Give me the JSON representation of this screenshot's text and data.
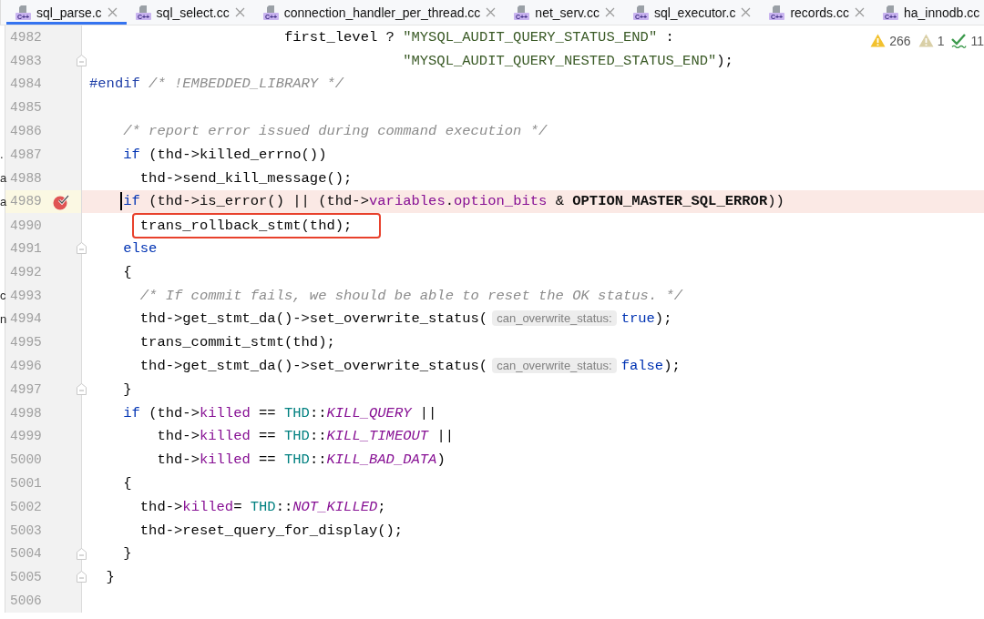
{
  "tabs": [
    {
      "label": "sql_parse.c",
      "icon_label": "C++",
      "selected": true
    },
    {
      "label": "sql_select.cc",
      "icon_label": "C++",
      "selected": false
    },
    {
      "label": "connection_handler_per_thread.cc",
      "icon_label": "C++",
      "selected": false
    },
    {
      "label": "net_serv.cc",
      "icon_label": "C++",
      "selected": false
    },
    {
      "label": "sql_executor.c",
      "icon_label": "C++",
      "selected": false
    },
    {
      "label": "records.cc",
      "icon_label": "C++",
      "selected": false
    },
    {
      "label": "ha_innodb.cc",
      "icon_label": "C++",
      "selected": false
    }
  ],
  "inspections": [
    {
      "kind": "warning",
      "count": "266"
    },
    {
      "kind": "weak_warning",
      "count": "1"
    },
    {
      "kind": "typo",
      "count": "11"
    }
  ],
  "lines": [
    {
      "number": "4982",
      "breakpoint": false,
      "fold_marker": false,
      "annotated": false,
      "caret": false,
      "tokens": [
        {
          "kind": "plain",
          "text": "                       first_level ? "
        },
        {
          "kind": "string",
          "text": "\"MYSQL_AUDIT_QUERY_STATUS_END\""
        },
        {
          "kind": "plain",
          "text": " :"
        }
      ]
    },
    {
      "number": "4983",
      "breakpoint": false,
      "fold_marker": true,
      "annotated": false,
      "caret": false,
      "tokens": [
        {
          "kind": "string",
          "text": "                                     \"MYSQL_AUDIT_QUERY_NESTED_STATUS_END\""
        },
        {
          "kind": "plain",
          "text": ");"
        }
      ]
    },
    {
      "number": "4984",
      "breakpoint": false,
      "fold_marker": false,
      "annotated": false,
      "caret": false,
      "tokens": [
        {
          "kind": "preproc",
          "text": "#endif"
        },
        {
          "kind": "comment",
          "text": " /* !EMBEDDED_LIBRARY */"
        }
      ]
    },
    {
      "number": "4985",
      "breakpoint": false,
      "fold_marker": false,
      "annotated": false,
      "caret": false
    },
    {
      "number": "4986",
      "breakpoint": false,
      "fold_marker": false,
      "annotated": false,
      "caret": false,
      "tokens": [
        {
          "kind": "comment",
          "text": "    /* report error issued during command execution */"
        }
      ]
    },
    {
      "number": "4987",
      "side_text": ".",
      "breakpoint": false,
      "fold_marker": false,
      "annotated": false,
      "caret": false,
      "tokens": [
        {
          "kind": "keyword",
          "text": "    if"
        },
        {
          "kind": "plain",
          "text": " (thd->killed_errno())"
        }
      ]
    },
    {
      "number": "4988",
      "side_text": "a",
      "breakpoint": false,
      "fold_marker": false,
      "annotated": false,
      "caret": false,
      "tokens": [
        {
          "kind": "plain",
          "text": "      thd->send_kill_message();"
        }
      ]
    },
    {
      "number": "4989",
      "side_text": "a",
      "breakpoint": true,
      "fold_marker": false,
      "annotated": false,
      "caret": true,
      "tokens": [
        {
          "kind": "keyword",
          "text": "    if"
        },
        {
          "kind": "plain",
          "text": " (thd->is_error() || (thd->"
        },
        {
          "kind": "member",
          "text": "variables"
        },
        {
          "kind": "plain",
          "text": "."
        },
        {
          "kind": "member",
          "text": "option_bits"
        },
        {
          "kind": "plain",
          "text": " & "
        },
        {
          "kind": "macro",
          "text": "OPTION_MASTER_SQL_ERROR"
        },
        {
          "kind": "plain",
          "text": "))"
        }
      ]
    },
    {
      "number": "4990",
      "breakpoint": false,
      "fold_marker": false,
      "annotated": true,
      "caret": false,
      "tokens": [
        {
          "kind": "plain",
          "text": "      trans_rollback_stmt(thd);"
        }
      ]
    },
    {
      "number": "4991",
      "breakpoint": false,
      "fold_marker": true,
      "annotated": false,
      "caret": false,
      "tokens": [
        {
          "kind": "keyword",
          "text": "    else"
        }
      ]
    },
    {
      "number": "4992",
      "breakpoint": false,
      "fold_marker": false,
      "annotated": false,
      "caret": false,
      "tokens": [
        {
          "kind": "plain",
          "text": "    {"
        }
      ]
    },
    {
      "number": "4993",
      "side_text": "c",
      "breakpoint": false,
      "fold_marker": false,
      "annotated": false,
      "caret": false,
      "tokens": [
        {
          "kind": "comment",
          "text": "      /* If commit fails, we should be able to reset the OK status. */"
        }
      ]
    },
    {
      "number": "4994",
      "side_text": "n",
      "breakpoint": false,
      "fold_marker": false,
      "annotated": false,
      "caret": false,
      "tokens": [
        {
          "kind": "plain",
          "text": "      thd->get_stmt_da()->set_overwrite_status("
        },
        {
          "kind": "hint",
          "text": "can_overwrite_status:"
        },
        {
          "kind": "keyword",
          "text": "true"
        },
        {
          "kind": "plain",
          "text": ");"
        }
      ]
    },
    {
      "number": "4995",
      "breakpoint": false,
      "fold_marker": false,
      "annotated": false,
      "caret": false,
      "tokens": [
        {
          "kind": "plain",
          "text": "      trans_commit_stmt(thd);"
        }
      ]
    },
    {
      "number": "4996",
      "breakpoint": false,
      "fold_marker": false,
      "annotated": false,
      "caret": false,
      "tokens": [
        {
          "kind": "plain",
          "text": "      thd->get_stmt_da()->set_overwrite_status("
        },
        {
          "kind": "hint",
          "text": "can_overwrite_status:"
        },
        {
          "kind": "keyword",
          "text": "false"
        },
        {
          "kind": "plain",
          "text": ");"
        }
      ]
    },
    {
      "number": "4997",
      "breakpoint": false,
      "fold_marker": true,
      "annotated": false,
      "caret": false,
      "tokens": [
        {
          "kind": "plain",
          "text": "    }"
        }
      ]
    },
    {
      "number": "4998",
      "breakpoint": false,
      "fold_marker": false,
      "annotated": false,
      "caret": false,
      "tokens": [
        {
          "kind": "keyword",
          "text": "    if"
        },
        {
          "kind": "plain",
          "text": " (thd->"
        },
        {
          "kind": "member",
          "text": "killed"
        },
        {
          "kind": "plain",
          "text": " == "
        },
        {
          "kind": "type",
          "text": "THD"
        },
        {
          "kind": "plain",
          "text": "::"
        },
        {
          "kind": "enum",
          "text": "KILL_QUERY"
        },
        {
          "kind": "plain",
          "text": " ||"
        }
      ]
    },
    {
      "number": "4999",
      "breakpoint": false,
      "fold_marker": false,
      "annotated": false,
      "caret": false,
      "tokens": [
        {
          "kind": "plain",
          "text": "        thd->"
        },
        {
          "kind": "member",
          "text": "killed"
        },
        {
          "kind": "plain",
          "text": " == "
        },
        {
          "kind": "type",
          "text": "THD"
        },
        {
          "kind": "plain",
          "text": "::"
        },
        {
          "kind": "enum",
          "text": "KILL_TIMEOUT"
        },
        {
          "kind": "plain",
          "text": " ||"
        }
      ]
    },
    {
      "number": "5000",
      "breakpoint": false,
      "fold_marker": false,
      "annotated": false,
      "caret": false,
      "tokens": [
        {
          "kind": "plain",
          "text": "        thd->"
        },
        {
          "kind": "member",
          "text": "killed"
        },
        {
          "kind": "plain",
          "text": " == "
        },
        {
          "kind": "type",
          "text": "THD"
        },
        {
          "kind": "plain",
          "text": "::"
        },
        {
          "kind": "enum",
          "text": "KILL_BAD_DATA"
        },
        {
          "kind": "plain",
          "text": ")"
        }
      ]
    },
    {
      "number": "5001",
      "breakpoint": false,
      "fold_marker": false,
      "annotated": false,
      "caret": false,
      "tokens": [
        {
          "kind": "plain",
          "text": "    {"
        }
      ]
    },
    {
      "number": "5002",
      "breakpoint": false,
      "fold_marker": false,
      "annotated": false,
      "caret": false,
      "tokens": [
        {
          "kind": "plain",
          "text": "      thd->"
        },
        {
          "kind": "member",
          "text": "killed"
        },
        {
          "kind": "plain",
          "text": "= "
        },
        {
          "kind": "type",
          "text": "THD"
        },
        {
          "kind": "plain",
          "text": "::"
        },
        {
          "kind": "enum",
          "text": "NOT_KILLED"
        },
        {
          "kind": "plain",
          "text": ";"
        }
      ]
    },
    {
      "number": "5003",
      "breakpoint": false,
      "fold_marker": false,
      "annotated": false,
      "caret": false,
      "tokens": [
        {
          "kind": "plain",
          "text": "      thd->reset_query_for_display();"
        }
      ]
    },
    {
      "number": "5004",
      "breakpoint": false,
      "fold_marker": true,
      "annotated": false,
      "caret": false,
      "tokens": [
        {
          "kind": "plain",
          "text": "    }"
        }
      ]
    },
    {
      "number": "5005",
      "breakpoint": false,
      "fold_marker": true,
      "annotated": false,
      "caret": false,
      "tokens": [
        {
          "kind": "plain",
          "text": "  }"
        }
      ]
    },
    {
      "number": "5006",
      "breakpoint": false,
      "fold_marker": false,
      "annotated": false,
      "caret": false
    }
  ]
}
